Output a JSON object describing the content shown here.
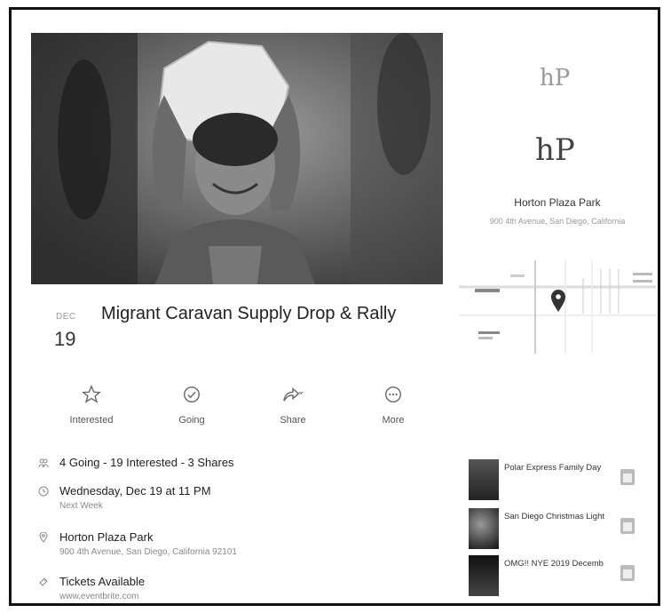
{
  "event": {
    "month": "DEC",
    "day": "19",
    "title": "Migrant Caravan Supply Drop & Rally"
  },
  "actions": [
    {
      "label": "Interested",
      "icon": "star-icon"
    },
    {
      "label": "Going",
      "icon": "check-circle-icon"
    },
    {
      "label": "Share",
      "icon": "share-icon"
    },
    {
      "label": "More",
      "icon": "more-icon"
    }
  ],
  "details": {
    "attendance": "4 Going - 19 Interested - 3 Shares",
    "datetime": "Wednesday, Dec 19 at 11 PM",
    "datetime_sub": "Next Week",
    "place": "Horton Plaza Park",
    "place_sub": "900 4th Avenue, San Diego, California 92101",
    "tickets": "Tickets Available",
    "tickets_sub": "www.eventbrite.com"
  },
  "venue": {
    "logo": "hP",
    "name": "Horton Plaza Park",
    "address": "900 4th Avenue, San Diego, California"
  },
  "suggested": [
    {
      "title": "Polar Express Family Day"
    },
    {
      "title": "San Diego Christmas Light"
    },
    {
      "title": "OMG!! NYE 2019 Decemb"
    }
  ]
}
